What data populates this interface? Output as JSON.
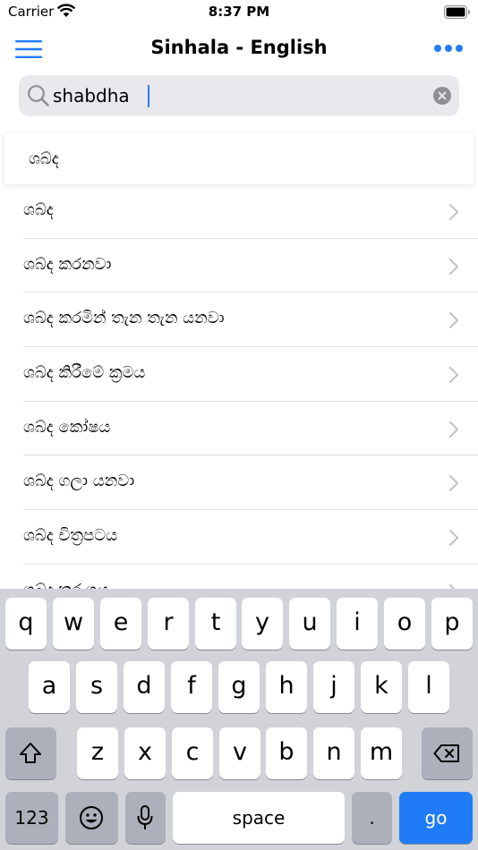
{
  "status": {
    "carrier": "Carrier",
    "time": "8:37 PM"
  },
  "nav": {
    "title": "Sinhala - English"
  },
  "search": {
    "value": "shabdha"
  },
  "suggestion": "ශබ්ද",
  "results": [
    "ශබ්ද",
    "ශබ්ද කරනවා",
    "ශබ්ද කරමින් තැන තැන යනවා",
    "ශබ්ද කිරීමේ ක්‍රමය",
    "ශබ්ද කෝෂය",
    "ශබ්ද ගලා යනවා",
    "ශබ්ද චිත්‍රපටය",
    "ශබ්ද තරංගය"
  ],
  "keyboard": {
    "row1": [
      "q",
      "w",
      "e",
      "r",
      "t",
      "y",
      "u",
      "i",
      "o",
      "p"
    ],
    "row2": [
      "a",
      "s",
      "d",
      "f",
      "g",
      "h",
      "j",
      "k",
      "l"
    ],
    "row3": [
      "z",
      "x",
      "c",
      "v",
      "b",
      "n",
      "m"
    ],
    "numbers_label": "123",
    "space_label": "space",
    "period_label": ".",
    "go_label": "go"
  },
  "colors": {
    "accent": "#1f7cf6",
    "keyboard_bg": "#d1d3d9"
  }
}
